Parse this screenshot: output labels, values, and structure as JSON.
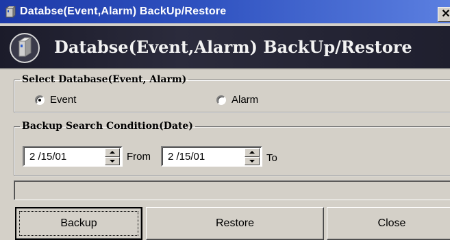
{
  "window": {
    "title": "Databse(Event,Alarm) BackUp/Restore",
    "close_label": "✕",
    "accent": "#2f52c0",
    "icons": [
      "app-icon",
      "close-icon",
      "database-icon"
    ]
  },
  "banner": {
    "title": "Databse(Event,Alarm) BackUp/Restore"
  },
  "select_db": {
    "legend": "Select Database(Event, Alarm)",
    "options": [
      {
        "label": "Event",
        "checked": true
      },
      {
        "label": "Alarm",
        "checked": false
      }
    ]
  },
  "backup_condition": {
    "legend": "Backup Search Condition(Date)",
    "from_value": "2 /15/01",
    "from_label": "From",
    "to_value": "2 /15/01",
    "to_label": "To"
  },
  "status": {
    "text": ""
  },
  "buttons": {
    "backup": "Backup",
    "restore": "Restore",
    "close": "Close"
  }
}
